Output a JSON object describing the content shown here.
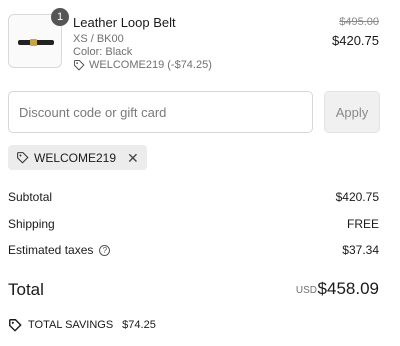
{
  "product": {
    "quantity": "1",
    "name": "Leather Loop Belt",
    "variant": "XS / BK00",
    "color": "Color: Black",
    "discount_line": "WELCOME219 (-$74.25)",
    "original_price": "$495.00",
    "price": "$420.75"
  },
  "discount": {
    "placeholder": "Discount code or gift card",
    "apply_label": "Apply",
    "applied_code": "WELCOME219",
    "remove_glyph": "✕"
  },
  "summary": {
    "subtotal_label": "Subtotal",
    "subtotal_value": "$420.75",
    "shipping_label": "Shipping",
    "shipping_value": "FREE",
    "taxes_label": "Estimated taxes",
    "taxes_help": "?",
    "taxes_value": "$37.34",
    "total_label": "Total",
    "total_currency": "USD",
    "total_value": "$458.09",
    "savings_label": "TOTAL SAVINGS",
    "savings_value": "$74.25"
  },
  "icons": {
    "tag": "tag-icon",
    "help": "question-circle-icon",
    "close": "close-icon",
    "savings": "savings-tag-icon"
  }
}
